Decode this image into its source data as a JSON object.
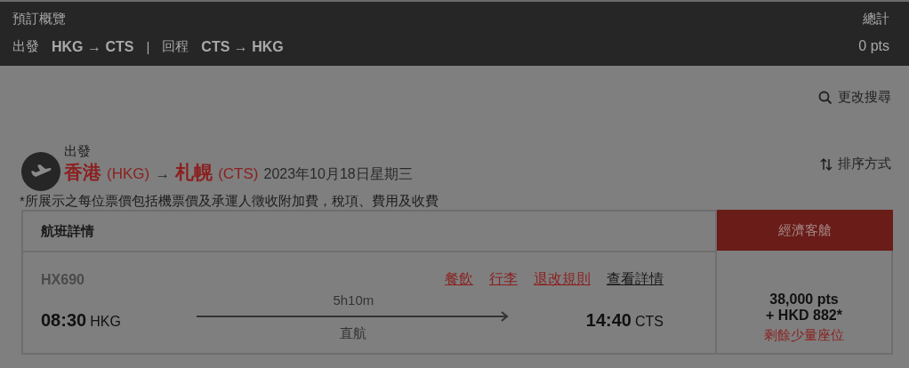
{
  "summary_bar": {
    "title": "預訂概覽",
    "outbound_label": "出發",
    "outbound_route": "HKG → CTS",
    "separator": "|",
    "return_label": "回程",
    "return_route": "CTS → HKG",
    "total_label": "總計",
    "total_value": "0 pts"
  },
  "modify_search": "更改搜尋",
  "sort": "排序方式",
  "segment": {
    "direction": "出發",
    "origin_city": "香港",
    "origin_code": "(HKG)",
    "arrow": "→",
    "dest_city": "札幌",
    "dest_code": "(CTS)",
    "date": "2023年10月18日星期三"
  },
  "fare_note": "*所展示之每位票價包括機票價及承運人徵收附加費，稅項、費用及收費",
  "table": {
    "details_heading": "航班詳情",
    "cabin_heading": "經濟客艙",
    "flights": [
      {
        "flight_no": "HX690",
        "links": [
          {
            "label": "餐飲",
            "kind": "accent"
          },
          {
            "label": "行李",
            "kind": "accent"
          },
          {
            "label": "退改規則",
            "kind": "accent"
          },
          {
            "label": "查看詳情",
            "kind": "plain"
          }
        ],
        "dep_time": "08:30",
        "dep_code": "HKG",
        "duration": "5h10m",
        "stops": "直航",
        "arr_time": "14:40",
        "arr_code": "CTS",
        "price_points": "38,000 pts",
        "price_cash": "+ HKD 882*",
        "availability": "剩餘少量座位"
      }
    ]
  }
}
